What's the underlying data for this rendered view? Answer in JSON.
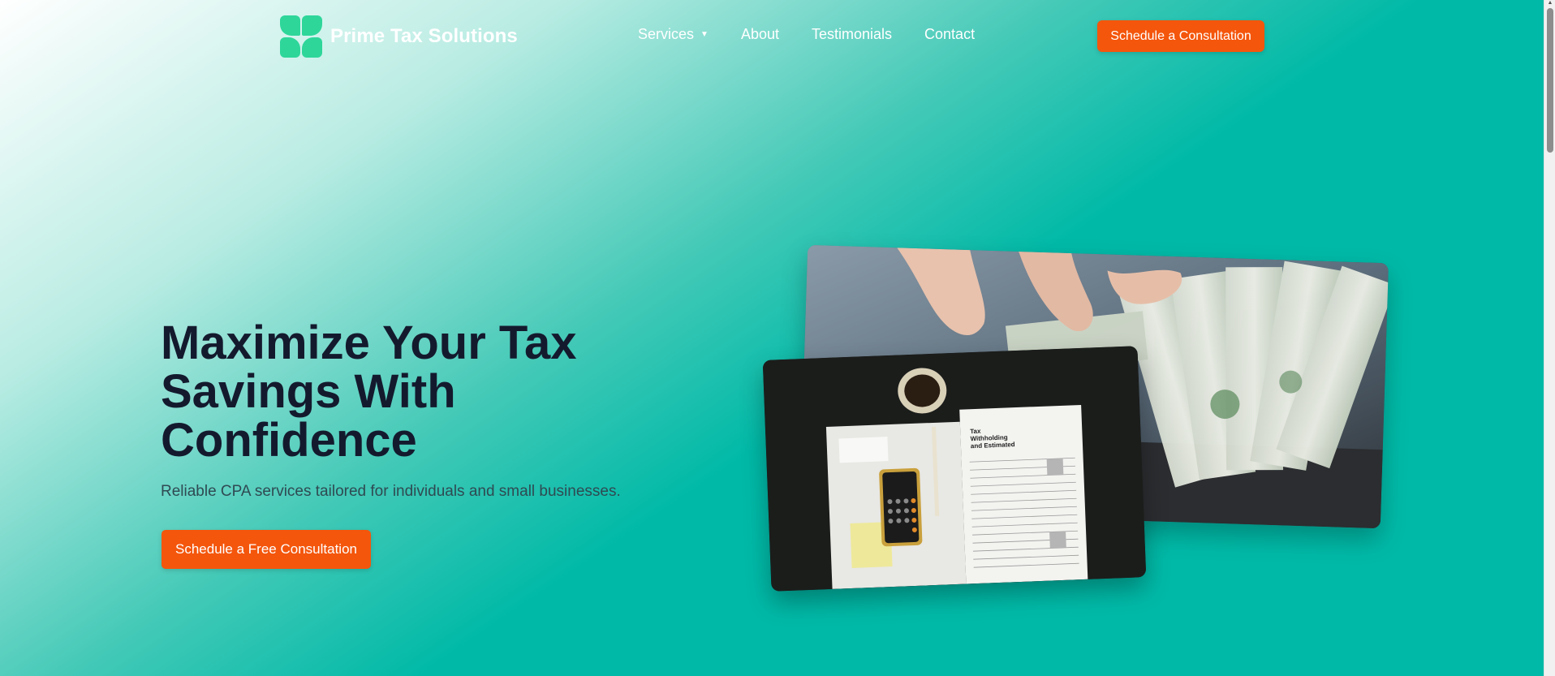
{
  "brand": {
    "name": "Prime Tax Solutions",
    "logo_icon": "four-leaf-logo-icon",
    "logo_color": "#2ed69a"
  },
  "nav": {
    "items": [
      {
        "label": "Services",
        "has_dropdown": true
      },
      {
        "label": "About"
      },
      {
        "label": "Testimonials"
      },
      {
        "label": "Contact"
      }
    ],
    "dropdown_caret": "▼"
  },
  "header": {
    "cta_label": "Schedule a Consultation"
  },
  "hero": {
    "title_lines": [
      "Maximize Your Tax",
      "Savings With",
      "Confidence"
    ],
    "subtitle": "Reliable CPA services tailored for individuals and small businesses.",
    "cta_label": "Schedule a Free Consultation",
    "images": [
      {
        "semantic": "hands-counting-hundred-dollar-bills-photo"
      },
      {
        "semantic": "tax-forms-calculator-coffee-photo"
      }
    ]
  },
  "colors": {
    "background": "#00b9a7",
    "accent": "#f4560c",
    "heading": "#141a2e",
    "subtitle": "#2f4a52"
  }
}
